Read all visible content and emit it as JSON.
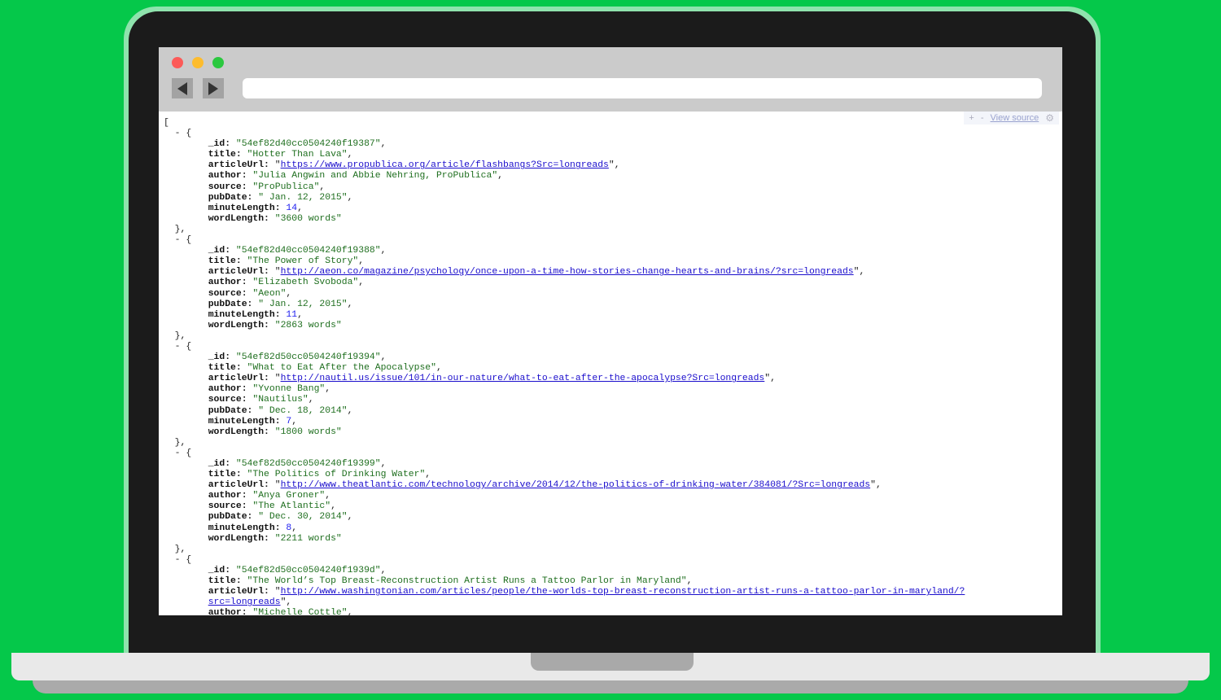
{
  "colors": {
    "background": "#05c84a",
    "string": "#1e6e1e",
    "number": "#1d1df0",
    "link": "#1a0dcc"
  },
  "browser": {
    "traffic_lights": [
      "close",
      "minimize",
      "maximize"
    ],
    "back_icon": "back-arrow-icon",
    "forward_icon": "forward-arrow-icon",
    "address_value": ""
  },
  "viewer_toolbar": {
    "expand": "+",
    "collapse": "-",
    "view_source": "View source",
    "settings_icon": "gear-icon"
  },
  "json": {
    "open_bracket": "[",
    "entries": [
      {
        "_id": "\"54ef82d40cc0504240f19387\"",
        "title": "\"Hotter Than Lava\"",
        "articleUrl": "https://www.propublica.org/article/flashbangs?Src=longreads",
        "author": "\"Julia Angwin and Abbie Nehring, ProPublica\"",
        "source": "\"ProPublica\"",
        "pubDate": "\" Jan. 12, 2015\"",
        "minuteLength": "14",
        "wordLength": "\"3600 words\""
      },
      {
        "_id": "\"54ef82d40cc0504240f19388\"",
        "title": "\"The Power of Story\"",
        "articleUrl": "http://aeon.co/magazine/psychology/once-upon-a-time-how-stories-change-hearts-and-brains/?src=longreads",
        "author": "\"Elizabeth Svoboda\"",
        "source": "\"Aeon\"",
        "pubDate": "\" Jan. 12, 2015\"",
        "minuteLength": "11",
        "wordLength": "\"2863 words\""
      },
      {
        "_id": "\"54ef82d50cc0504240f19394\"",
        "title": "\"What to Eat After the Apocalypse\"",
        "articleUrl": "http://nautil.us/issue/101/in-our-nature/what-to-eat-after-the-apocalypse?Src=longreads",
        "author": "\"Yvonne Bang\"",
        "source": "\"Nautilus\"",
        "pubDate": "\" Dec. 18, 2014\"",
        "minuteLength": "7",
        "wordLength": "\"1800 words\""
      },
      {
        "_id": "\"54ef82d50cc0504240f19399\"",
        "title": "\"The Politics of Drinking Water\"",
        "articleUrl": "http://www.theatlantic.com/technology/archive/2014/12/the-politics-of-drinking-water/384081/?Src=longreads",
        "author": "\"Anya Groner\"",
        "source": "\"The Atlantic\"",
        "pubDate": "\" Dec. 30, 2014\"",
        "minuteLength": "8",
        "wordLength": "\"2211 words\""
      }
    ],
    "partial_entry": {
      "_id": "\"54ef82d50cc0504240f1939d\"",
      "title": "\"The World’s Top Breast-Reconstruction Artist Runs a Tattoo Parlor in Maryland\"",
      "articleUrl_line1": "http://www.washingtonian.com/articles/people/the-worlds-top-breast-reconstruction-artist-runs-a-tattoo-parlor-in-maryland/?",
      "articleUrl_line2": "src=longreads",
      "author": "\"Michelle Cottle\""
    }
  }
}
